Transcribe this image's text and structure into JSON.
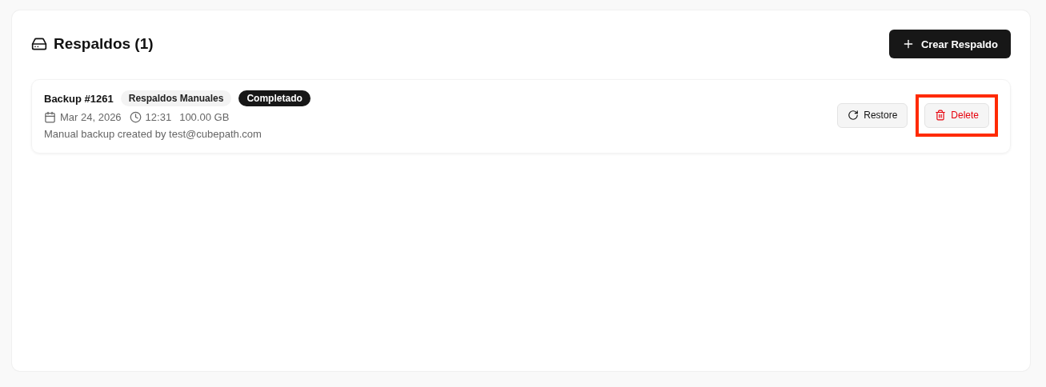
{
  "header": {
    "title": "Respaldos (1)",
    "create_button": "Crear Respaldo"
  },
  "backups": [
    {
      "name": "Backup #1261",
      "type_tag": "Respaldos Manuales",
      "status": "Completado",
      "date": "Mar 24, 2026",
      "time": "12:31",
      "size": "100.00 GB",
      "description": "Manual backup created by test@cubepath.com",
      "actions": [
        {
          "kind": "restore",
          "label": "Restore",
          "highlighted": false
        },
        {
          "kind": "delete",
          "label": "Delete",
          "highlighted": true
        }
      ]
    }
  ]
}
